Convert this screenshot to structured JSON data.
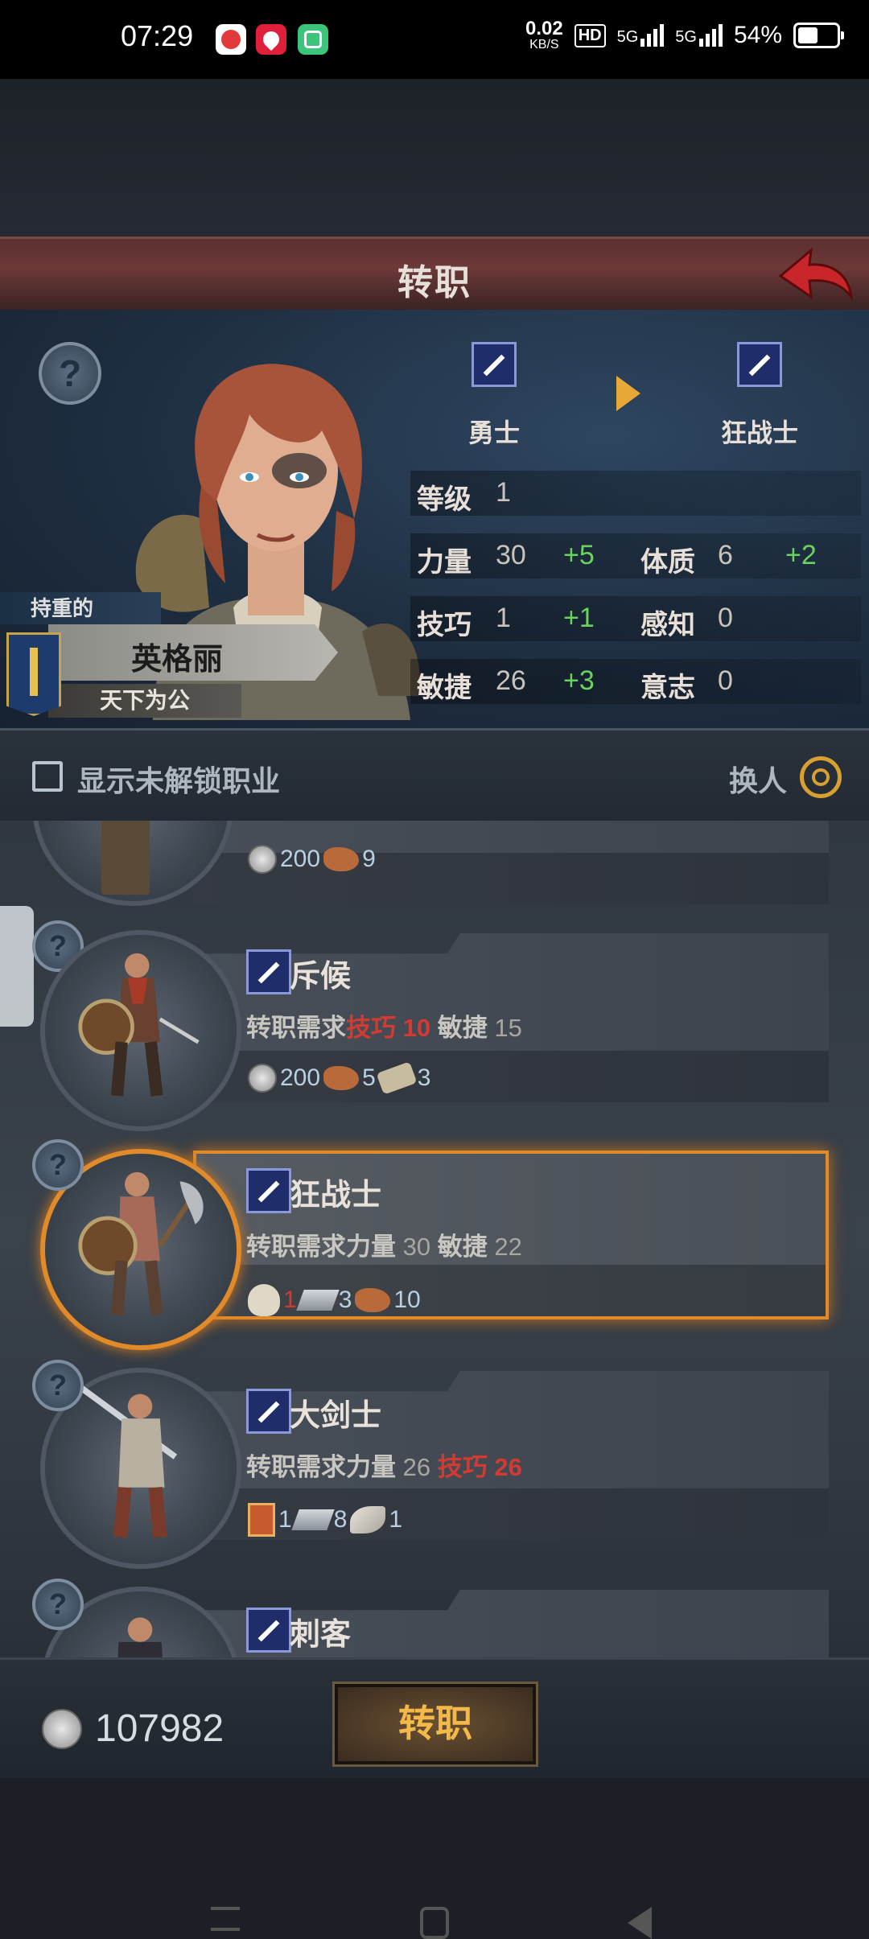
{
  "status_bar": {
    "time": "07:29",
    "net_speed_value": "0.02",
    "net_speed_unit": "KB/S",
    "hd": "HD",
    "net1": "5G",
    "net2": "5G",
    "battery": "54%"
  },
  "header": {
    "title": "转职"
  },
  "hero": {
    "from_class": "勇士",
    "to_class": "狂战士",
    "level_label": "等级",
    "level_value": "1",
    "stats": {
      "str_label": "力量",
      "str_value": "30",
      "str_bonus": "+5",
      "con_label": "体质",
      "con_value": "6",
      "con_bonus": "+2",
      "skill_label": "技巧",
      "skill_value": "1",
      "skill_bonus": "+1",
      "per_label": "感知",
      "per_value": "0",
      "agi_label": "敏捷",
      "agi_value": "26",
      "agi_bonus": "+3",
      "will_label": "意志",
      "will_value": "0"
    },
    "trait": "持重的",
    "name": "英格丽",
    "subtitle": "天下为公"
  },
  "filter": {
    "show_locked_label": "显示未解锁职业",
    "swap_label": "换人"
  },
  "list": {
    "req_prefix": "转职需求",
    "partial": {
      "coins": "200",
      "leather": "9"
    },
    "items": [
      {
        "name": "斥候",
        "r1_label": "技巧",
        "r1_value": "10",
        "r2_label": "敏捷",
        "r2_value": "15",
        "c1": "200",
        "c2": "5",
        "c3": "3"
      },
      {
        "name": "狂战士",
        "r1_label": "力量",
        "r1_value": "30",
        "r2_label": "敏捷",
        "r2_value": "22",
        "c1": "1",
        "c2": "3",
        "c3": "10"
      },
      {
        "name": "大剑士",
        "r1_label": "力量",
        "r1_value": "26",
        "r2_label": "技巧",
        "r2_value": "26",
        "c1": "1",
        "c2": "8",
        "c3": "1"
      },
      {
        "name": "刺客"
      }
    ]
  },
  "footer": {
    "money": "107982",
    "transfer_button": "转职"
  },
  "colors": {
    "selected_border": "#e08a2a",
    "bonus_green": "#6bd160",
    "unmet_red": "#d33a32",
    "button_text": "#f2b848"
  }
}
